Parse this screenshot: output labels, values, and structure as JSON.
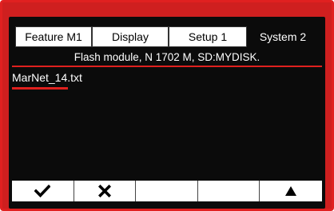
{
  "tabs": [
    {
      "label": "Feature  M1"
    },
    {
      "label": "Display"
    },
    {
      "label": "Setup 1"
    },
    {
      "label": "System 2"
    }
  ],
  "status_line": "Flash module, N 1702 M, SD:MYDISK.",
  "files": [
    {
      "name": "MarNet_14.txt"
    }
  ],
  "softkeys": [
    {
      "icon": "checkmark-icon"
    },
    {
      "icon": "cross-icon"
    },
    {
      "icon": ""
    },
    {
      "icon": ""
    },
    {
      "icon": "up-triangle-icon"
    }
  ]
}
